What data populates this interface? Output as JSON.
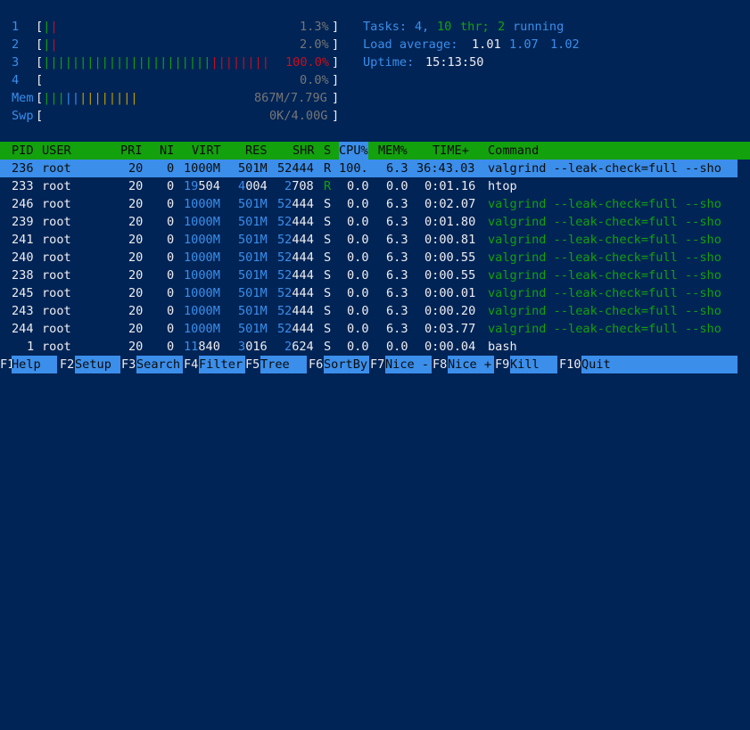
{
  "meters": {
    "cpu": [
      {
        "id": "1",
        "value": "1.3%"
      },
      {
        "id": "2",
        "value": "2.0%"
      },
      {
        "id": "3",
        "value": "100.0%"
      },
      {
        "id": "4",
        "value": "0.0%"
      }
    ],
    "mem": {
      "label": "Mem",
      "value": "867M/7.79G"
    },
    "swp": {
      "label": "Swp",
      "value": "0K/4.00G"
    }
  },
  "summary": {
    "tasks_label": "Tasks:",
    "tasks": "4",
    "thr": "10",
    "thr_label": "thr;",
    "running": "2",
    "running_label": "running",
    "load_label": "Load average:",
    "load1": "1.01",
    "load5": "1.07",
    "load15": "1.02",
    "uptime_label": "Uptime:",
    "uptime": "15:13:50"
  },
  "columns": {
    "pid": "PID",
    "user": "USER",
    "pri": "PRI",
    "ni": "NI",
    "virt": "VIRT",
    "res": "RES",
    "shr": "SHR",
    "s": "S",
    "cpu": "CPU%",
    "mem": "MEM%",
    "time": "TIME+",
    "command": "Command"
  },
  "processes": [
    {
      "pid": "236",
      "user": "root",
      "pri": "20",
      "ni": "0",
      "virt": "1000M",
      "res": "501M",
      "shr": "52444",
      "s": "R",
      "cpu": "100.",
      "mem": "6.3",
      "time": "36:43.03",
      "command": "valgrind --leak-check=full --sho"
    },
    {
      "pid": "233",
      "user": "root",
      "pri": "20",
      "ni": "0",
      "virt_hi": "19",
      "virt_lo": "504",
      "res_hi": "4",
      "res_lo": "004",
      "shr_hi": "2",
      "shr_lo": "708",
      "s": "R",
      "cpu": "0.0",
      "mem": "0.0",
      "time": "0:01.16",
      "command": "htop"
    },
    {
      "pid": "246",
      "user": "root",
      "pri": "20",
      "ni": "0",
      "virt": "1000M",
      "res": "501M",
      "shr_hi": "52",
      "shr_lo": "444",
      "s": "S",
      "cpu": "0.0",
      "mem": "6.3",
      "time": "0:02.07",
      "command": "valgrind --leak-check=full --sho"
    },
    {
      "pid": "239",
      "user": "root",
      "pri": "20",
      "ni": "0",
      "virt": "1000M",
      "res": "501M",
      "shr_hi": "52",
      "shr_lo": "444",
      "s": "S",
      "cpu": "0.0",
      "mem": "6.3",
      "time": "0:01.80",
      "command": "valgrind --leak-check=full --sho"
    },
    {
      "pid": "241",
      "user": "root",
      "pri": "20",
      "ni": "0",
      "virt": "1000M",
      "res": "501M",
      "shr_hi": "52",
      "shr_lo": "444",
      "s": "S",
      "cpu": "0.0",
      "mem": "6.3",
      "time": "0:00.81",
      "command": "valgrind --leak-check=full --sho"
    },
    {
      "pid": "240",
      "user": "root",
      "pri": "20",
      "ni": "0",
      "virt": "1000M",
      "res": "501M",
      "shr_hi": "52",
      "shr_lo": "444",
      "s": "S",
      "cpu": "0.0",
      "mem": "6.3",
      "time": "0:00.55",
      "command": "valgrind --leak-check=full --sho"
    },
    {
      "pid": "238",
      "user": "root",
      "pri": "20",
      "ni": "0",
      "virt": "1000M",
      "res": "501M",
      "shr_hi": "52",
      "shr_lo": "444",
      "s": "S",
      "cpu": "0.0",
      "mem": "6.3",
      "time": "0:00.55",
      "command": "valgrind --leak-check=full --sho"
    },
    {
      "pid": "245",
      "user": "root",
      "pri": "20",
      "ni": "0",
      "virt": "1000M",
      "res": "501M",
      "shr_hi": "52",
      "shr_lo": "444",
      "s": "S",
      "cpu": "0.0",
      "mem": "6.3",
      "time": "0:00.01",
      "command": "valgrind --leak-check=full --sho"
    },
    {
      "pid": "243",
      "user": "root",
      "pri": "20",
      "ni": "0",
      "virt": "1000M",
      "res": "501M",
      "shr_hi": "52",
      "shr_lo": "444",
      "s": "S",
      "cpu": "0.0",
      "mem": "6.3",
      "time": "0:00.20",
      "command": "valgrind --leak-check=full --sho"
    },
    {
      "pid": "244",
      "user": "root",
      "pri": "20",
      "ni": "0",
      "virt": "1000M",
      "res": "501M",
      "shr_hi": "52",
      "shr_lo": "444",
      "s": "S",
      "cpu": "0.0",
      "mem": "6.3",
      "time": "0:03.77",
      "command": "valgrind --leak-check=full --sho"
    },
    {
      "pid": "1",
      "user": "root",
      "pri": "20",
      "ni": "0",
      "virt_hi": "11",
      "virt_lo": "840",
      "res_hi": "3",
      "res_lo": "016",
      "shr_hi": "2",
      "shr_lo": "624",
      "s": "S",
      "cpu": "0.0",
      "mem": "0.0",
      "time": "0:00.04",
      "command": "bash"
    }
  ],
  "fkeys": [
    {
      "key": "F1",
      "label": "Help"
    },
    {
      "key": "F2",
      "label": "Setup"
    },
    {
      "key": "F3",
      "label": "Search"
    },
    {
      "key": "F4",
      "label": "Filter"
    },
    {
      "key": "F5",
      "label": "Tree"
    },
    {
      "key": "F6",
      "label": "SortBy"
    },
    {
      "key": "F7",
      "label": "Nice -"
    },
    {
      "key": "F8",
      "label": "Nice +"
    },
    {
      "key": "F9",
      "label": "Kill"
    },
    {
      "key": "F10",
      "label": "Quit"
    }
  ]
}
